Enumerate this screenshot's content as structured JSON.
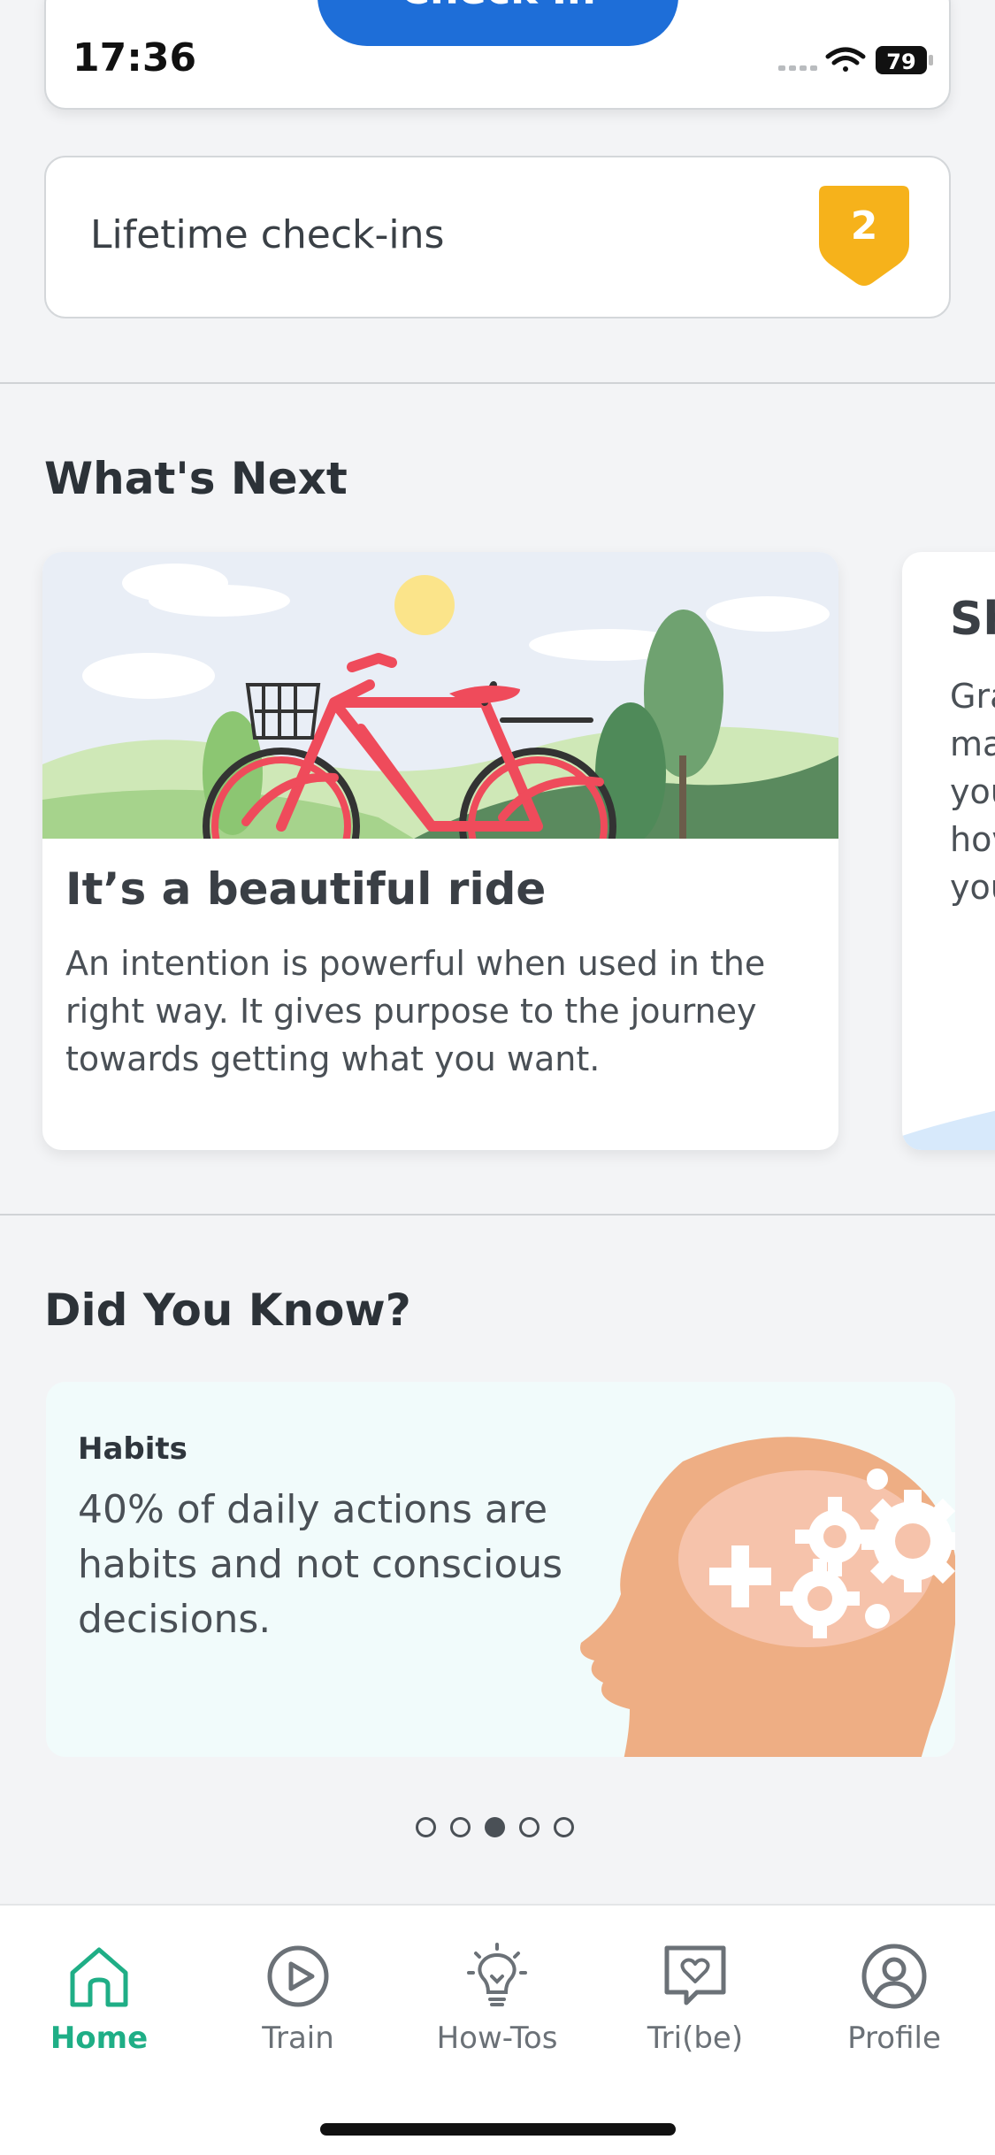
{
  "status_bar": {
    "time": "17:36",
    "battery": "79"
  },
  "top": {
    "checkin_label": "Check In"
  },
  "lifetime": {
    "label": "Lifetime check-ins",
    "count": "2"
  },
  "whats_next": {
    "title": "What's Next",
    "card1": {
      "title": "It’s a beautiful ride",
      "description": "An intention is powerful when used in the right way. It gives purpose to the journey towards getting what you want."
    },
    "card2": {
      "title_partial": "Sh",
      "lines_partial": [
        "Gra",
        "ma",
        "you",
        "hov",
        "you"
      ]
    }
  },
  "did_you_know": {
    "title": "Did You Know?",
    "category": "Habits",
    "text": "40% of daily actions are habits and not conscious decisions.",
    "pagination": {
      "total": 5,
      "active_index": 2
    }
  },
  "nav": {
    "items": [
      {
        "label": "Home",
        "icon": "home-icon",
        "active": true
      },
      {
        "label": "Train",
        "icon": "play-icon",
        "active": false
      },
      {
        "label": "How-Tos",
        "icon": "lightbulb-icon",
        "active": false
      },
      {
        "label": "Tri(be)",
        "icon": "heart-chat-icon",
        "active": false
      },
      {
        "label": "Profile",
        "icon": "profile-icon",
        "active": false
      }
    ]
  },
  "colors": {
    "accent_blue": "#1e6ed8",
    "active_green": "#1fae86",
    "badge_yellow": "#f6b21b"
  }
}
